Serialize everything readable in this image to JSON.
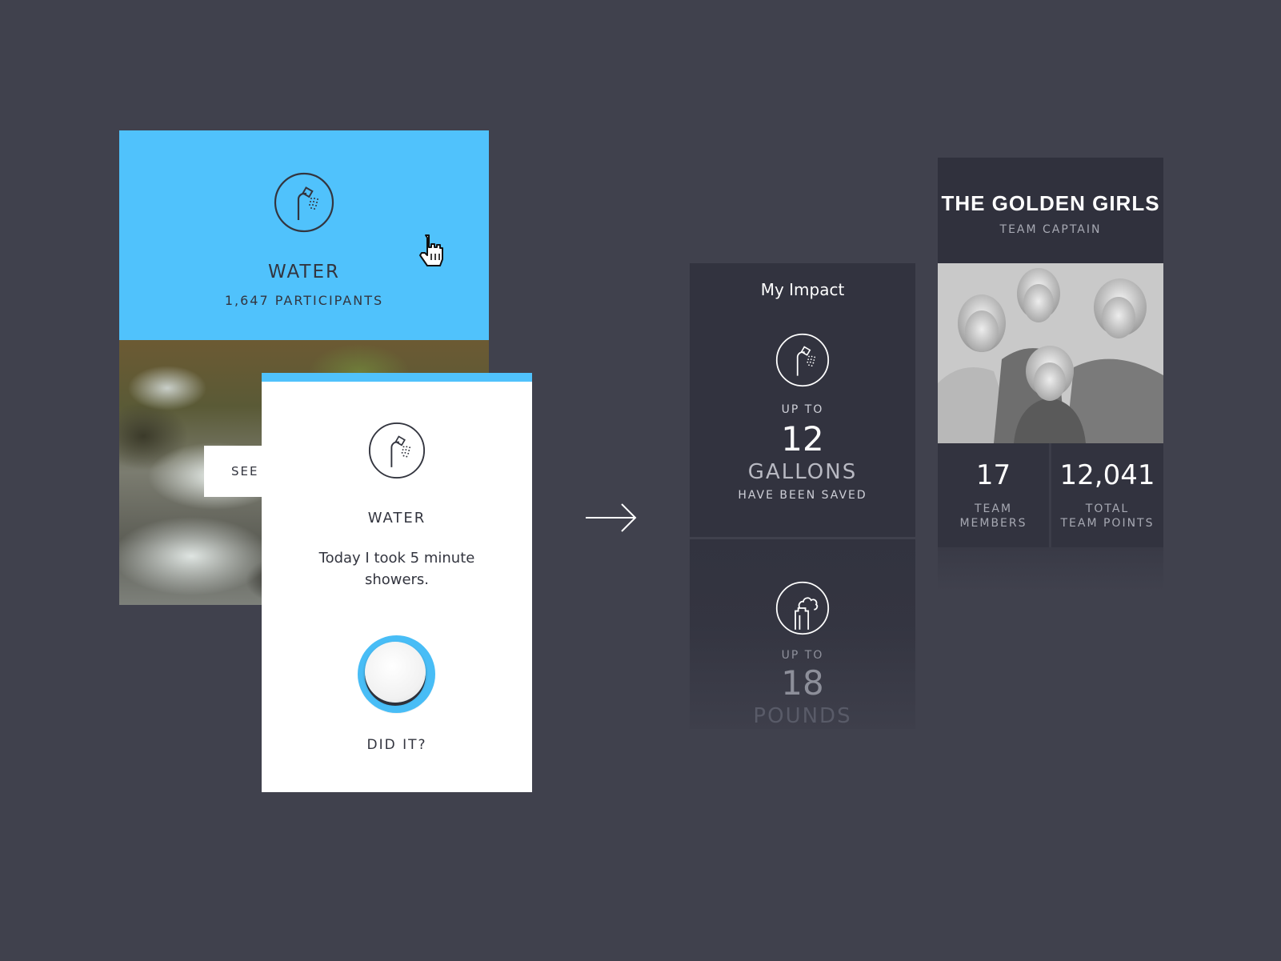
{
  "water_card": {
    "title": "WATER",
    "participants": "1,647 PARTICIPANTS",
    "see_button_label": "SEE",
    "icon": "shower-icon",
    "color": "#50c2fc"
  },
  "did_it_card": {
    "title": "WATER",
    "statement": "Today I took 5 minute showers.",
    "toggle_label": "DID IT?",
    "icon": "shower-icon"
  },
  "impact_card": {
    "title": "My Impact",
    "items": [
      {
        "icon": "shower-icon",
        "prefix": "UP TO",
        "value": "12",
        "unit": "GALLONS",
        "suffix": "HAVE BEEN SAVED"
      },
      {
        "icon": "smokestack-icon",
        "prefix": "UP TO",
        "value": "18",
        "unit": "POUNDS"
      }
    ]
  },
  "team_card": {
    "name": "THE GOLDEN GIRLS",
    "role": "TEAM CAPTAIN",
    "stats": [
      {
        "value": "17",
        "label_line1": "TEAM",
        "label_line2": "MEMBERS"
      },
      {
        "value": "12,041",
        "label_line1": "TOTAL",
        "label_line2": "TEAM POINTS"
      }
    ]
  },
  "colors": {
    "background": "#40414d",
    "card_dark": "#32333f",
    "accent_blue": "#50c2fc"
  }
}
